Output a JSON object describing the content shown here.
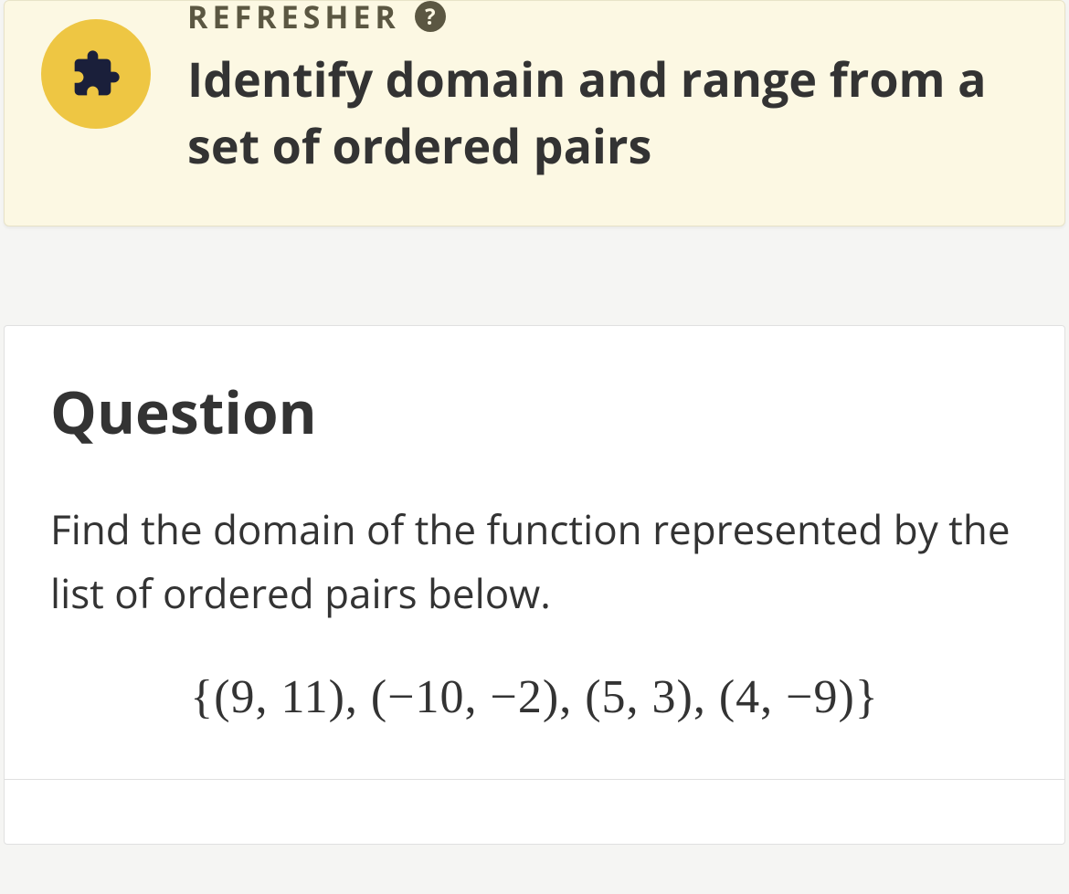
{
  "refresher": {
    "label": "REFRESHER",
    "title": "Identify domain and range from a set of ordered pairs",
    "icon": "puzzle-piece-icon",
    "help": "?"
  },
  "question": {
    "heading": "Question",
    "prompt": "Find the domain of the function represented by the list of ordered pairs below.",
    "expression": "{(9, 11), (−10, −2), (5, 3), (4, −9)}"
  }
}
